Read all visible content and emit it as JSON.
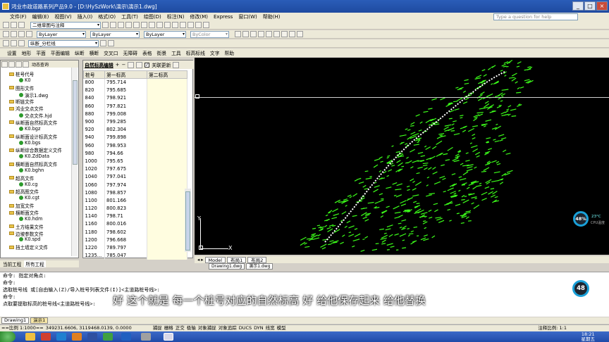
{
  "window": {
    "title": "鸿业市政道路系列产品9.0 - [D:\\HySzWork\\演示\\演示1.dwg]"
  },
  "menu": {
    "items": [
      "文件(F)",
      "编辑(E)",
      "视图(V)",
      "插入(I)",
      "格式(O)",
      "工具(T)",
      "绘图(D)",
      "标注(N)",
      "修改(M)",
      "Express",
      "窗口(W)",
      "帮助(H)"
    ],
    "help_placeholder": "Type a question for help"
  },
  "toolbar": {
    "workspace": "二维草图与注释",
    "layer": "ByLayer",
    "linetype": "ByLayer",
    "lineweight": "ByLayer",
    "color": "ByColor",
    "layer_name": "纵断_分栏线"
  },
  "chinamenu": {
    "items": [
      "设置",
      "地形",
      "平面",
      "平面编辑",
      "纵断",
      "横断",
      "交叉口",
      "无障碍",
      "表格",
      "街景",
      "工具",
      "标高标线",
      "文字",
      "帮助"
    ]
  },
  "tree": {
    "header_label": "动态查询",
    "items": [
      "桩号代号",
      "K0",
      "图形文件",
      "演示1.dwg",
      "断链文件",
      "鸿业交点文件",
      "交点文件.hjd",
      "纵断面自然标高文件",
      "K0.bgz",
      "纵断面设计标高文件",
      "K0.bgs",
      "纵断综合数据定义文件",
      "K0.ZdData",
      "横断面自然标高文件",
      "K0.bghn",
      "超高文件",
      "K0.cg",
      "超高图文件",
      "K0.cgt",
      "加宽文件",
      "横断面文件",
      "K0.hdm",
      "土方结果文件",
      "边坡参数文件",
      "K0.spd",
      "挡土墙定义文件"
    ],
    "tabs": [
      "当前工程",
      "所有工程"
    ]
  },
  "editor": {
    "title": "自然标高编辑",
    "close_label": "关联更新",
    "headers": [
      "桩号",
      "第一标高",
      "第二标高"
    ],
    "rows": [
      [
        "800",
        "795.714"
      ],
      [
        "820",
        "795.685"
      ],
      [
        "840",
        "798.921"
      ],
      [
        "860",
        "797.821"
      ],
      [
        "880",
        "799.008"
      ],
      [
        "900",
        "799.285"
      ],
      [
        "920",
        "802.304"
      ],
      [
        "940",
        "799.898"
      ],
      [
        "960",
        "798.953"
      ],
      [
        "980",
        "794.66"
      ],
      [
        "1000",
        "795.65"
      ],
      [
        "1020",
        "797.675"
      ],
      [
        "1040",
        "797.041"
      ],
      [
        "1060",
        "797.974"
      ],
      [
        "1080",
        "798.857"
      ],
      [
        "1100",
        "801.166"
      ],
      [
        "1120",
        "800.823"
      ],
      [
        "1140",
        "798.71"
      ],
      [
        "1160",
        "800.016"
      ],
      [
        "1180",
        "798.602"
      ],
      [
        "1200",
        "796.668"
      ],
      [
        "1220",
        "789.797"
      ],
      [
        "1235...",
        "785.047"
      ]
    ]
  },
  "layout_tabs": {
    "model": "Model",
    "layout1": "布局1",
    "layout2": "布局2",
    "files": [
      "Drawing1.dwg",
      "演示1.dwg"
    ]
  },
  "command": {
    "lines": [
      "命令: 指定对角点:",
      "命令:",
      "选取桩号线 或[自由输入(Z)/导入桩号列表文件(I)]<主道路桩号线>:",
      "命令:",
      "点取要提取标高的桩号线<主道路桩号线>:"
    ]
  },
  "subtitle": "好 这个就是 每一个桩号对应的自然标高 好 给他保存起来 给他替换",
  "bottom_tabs": [
    "Drawing1",
    "演示1"
  ],
  "status": {
    "scale_text": "==比例 1:1000==",
    "coords": "349231.6606, 3119468.0139, 0.0000",
    "toggles": [
      "捕捉",
      "栅格",
      "正交",
      "极轴",
      "对象捕捉",
      "对象追踪",
      "DUCS",
      "DYN",
      "线宽",
      "模型"
    ],
    "annotation_scale": "注释比例: 1:1"
  },
  "gauges": {
    "cpu_value": "48%",
    "temp": "23°C",
    "cpu_label": "CPU温度",
    "second_value": "48"
  },
  "clock": {
    "time": "18:21",
    "weekday": "星期五"
  },
  "ucs": {
    "x_label": "X",
    "y_label": "Y"
  },
  "colors": {
    "titlebar": "#2a5db8",
    "terrain": "#3cff1a",
    "drawing_bg": "#000000"
  }
}
